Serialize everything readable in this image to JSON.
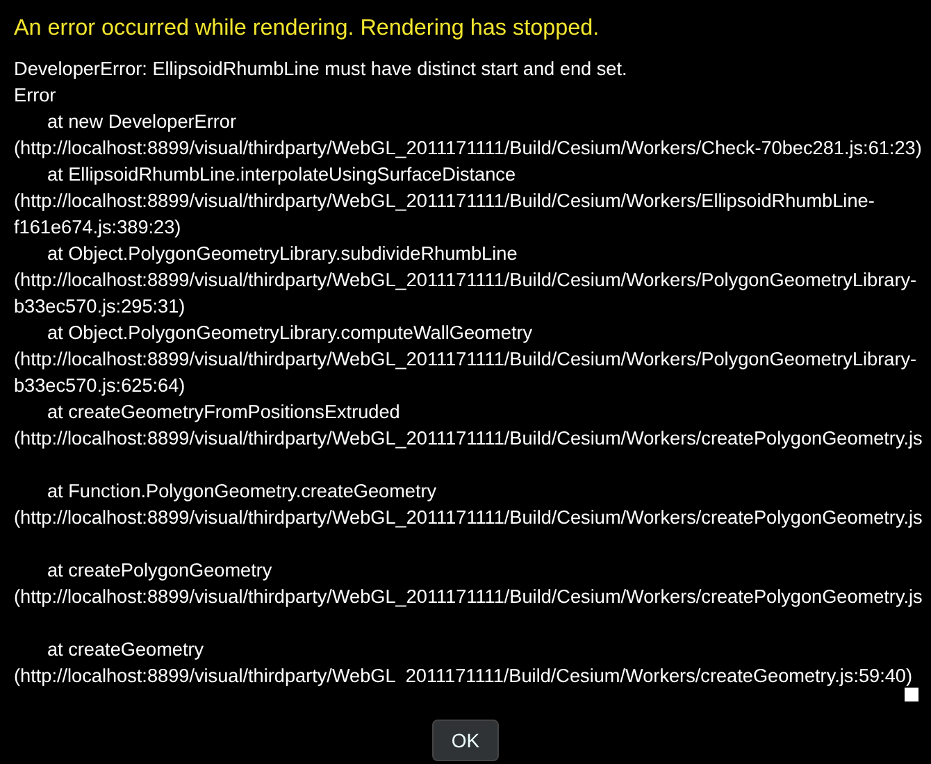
{
  "title": "An error occurred while rendering. Rendering has stopped.",
  "message": "DeveloperError: EllipsoidRhumbLine must have distinct start and end set.",
  "error_label": "Error",
  "stack_lines": [
    {
      "kind": "call",
      "text": "at new DeveloperError"
    },
    {
      "kind": "location",
      "text": "(http://localhost:8899/visual/thirdparty/WebGL_2011171111/Build/Cesium/Workers/Check-70bec281.js:61:23)"
    },
    {
      "kind": "call",
      "text": "at EllipsoidRhumbLine.interpolateUsingSurfaceDistance"
    },
    {
      "kind": "location",
      "text": "(http://localhost:8899/visual/thirdparty/WebGL_2011171111/Build/Cesium/Workers/EllipsoidRhumbLine-"
    },
    {
      "kind": "location",
      "text": "f161e674.js:389:23)"
    },
    {
      "kind": "call",
      "text": "at Object.PolygonGeometryLibrary.subdivideRhumbLine"
    },
    {
      "kind": "location",
      "text": "(http://localhost:8899/visual/thirdparty/WebGL_2011171111/Build/Cesium/Workers/PolygonGeometryLibrary-"
    },
    {
      "kind": "location",
      "text": "b33ec570.js:295:31)"
    },
    {
      "kind": "call",
      "text": "at Object.PolygonGeometryLibrary.computeWallGeometry"
    },
    {
      "kind": "location",
      "text": "(http://localhost:8899/visual/thirdparty/WebGL_2011171111/Build/Cesium/Workers/PolygonGeometryLibrary-"
    },
    {
      "kind": "location",
      "text": "b33ec570.js:625:64)"
    },
    {
      "kind": "call",
      "text": "at createGeometryFromPositionsExtruded"
    },
    {
      "kind": "location",
      "text": "(http://localhost:8899/visual/thirdparty/WebGL_2011171111/Build/Cesium/Workers/createPolygonGeometry.js"
    },
    {
      "kind": "blank"
    },
    {
      "kind": "call",
      "text": "at Function.PolygonGeometry.createGeometry"
    },
    {
      "kind": "location",
      "text": "(http://localhost:8899/visual/thirdparty/WebGL_2011171111/Build/Cesium/Workers/createPolygonGeometry.js"
    },
    {
      "kind": "blank"
    },
    {
      "kind": "call",
      "text": "at createPolygonGeometry"
    },
    {
      "kind": "location",
      "text": "(http://localhost:8899/visual/thirdparty/WebGL_2011171111/Build/Cesium/Workers/createPolygonGeometry.js"
    },
    {
      "kind": "blank"
    },
    {
      "kind": "call",
      "text": "at createGeometry"
    },
    {
      "kind": "location",
      "text": "(http://localhost:8899/visual/thirdparty/WebGL  2011171111/Build/Cesium/Workers/createGeometry.js:59:40)"
    }
  ],
  "button": "OK"
}
